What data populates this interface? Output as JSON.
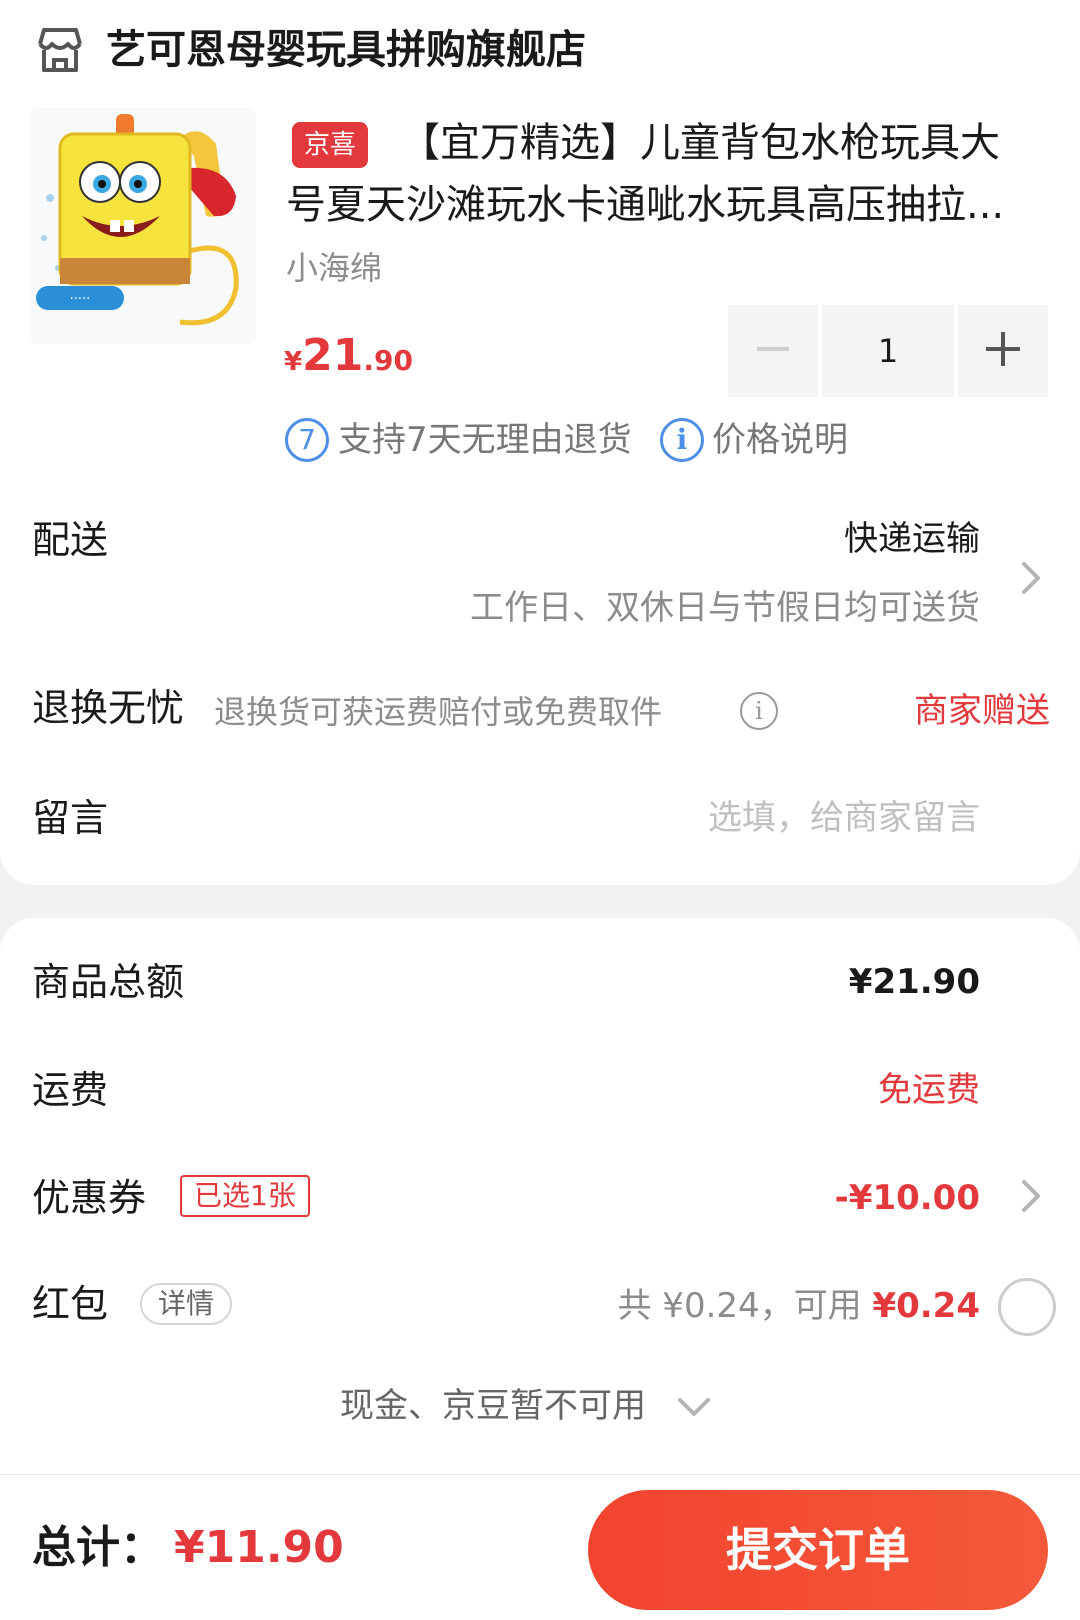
{
  "colors": {
    "accent": "#e4393c",
    "info_blue": "#4d8fe6",
    "muted": "#8c8c8c",
    "background": "#f2f2f2"
  },
  "store": {
    "icon": "store-icon",
    "name": "艺可恩母婴玩具拼购旗舰店"
  },
  "product": {
    "badge": "京喜",
    "title_line1": "【宜万精选】儿童背包水枪玩具大",
    "title_line2": "号夏天沙滩玩水卡通呲水玩具高压抽拉...",
    "variant": "小海绵",
    "price_currency": "¥",
    "price_int": "21",
    "price_dec": ".90",
    "quantity": "1",
    "minus_icon": "minus-icon",
    "plus_icon": "plus-icon",
    "service1_icon_text": "7",
    "service1": "支持7天无理由退货",
    "service2_icon_text": "i",
    "service2": "价格说明"
  },
  "delivery": {
    "label": "配送",
    "value": "快递运输",
    "sub": "工作日、双休日与节假日均可送货"
  },
  "returns": {
    "label": "退换无忧",
    "desc": "退换货可获运费赔付或免费取件",
    "info_icon_text": "i",
    "value": "商家赠送"
  },
  "note": {
    "label": "留言",
    "placeholder": "选填，给商家留言",
    "value": ""
  },
  "summary": {
    "subtotal_label": "商品总额",
    "subtotal_value": "¥21.90",
    "shipping_label": "运费",
    "shipping_value": "免运费",
    "coupon_label": "优惠券",
    "coupon_tag": "已选1张",
    "coupon_value": "-¥10.00",
    "redpacket_label": "红包",
    "redpacket_detail": "详情",
    "redpacket_total_prefix": "共 ¥0.24，可用 ",
    "redpacket_available": "¥0.24",
    "cash_note": "现金、京豆暂不可用"
  },
  "footer": {
    "total_label": "总计：",
    "total_value": "¥11.90",
    "submit_label": "提交订单"
  }
}
